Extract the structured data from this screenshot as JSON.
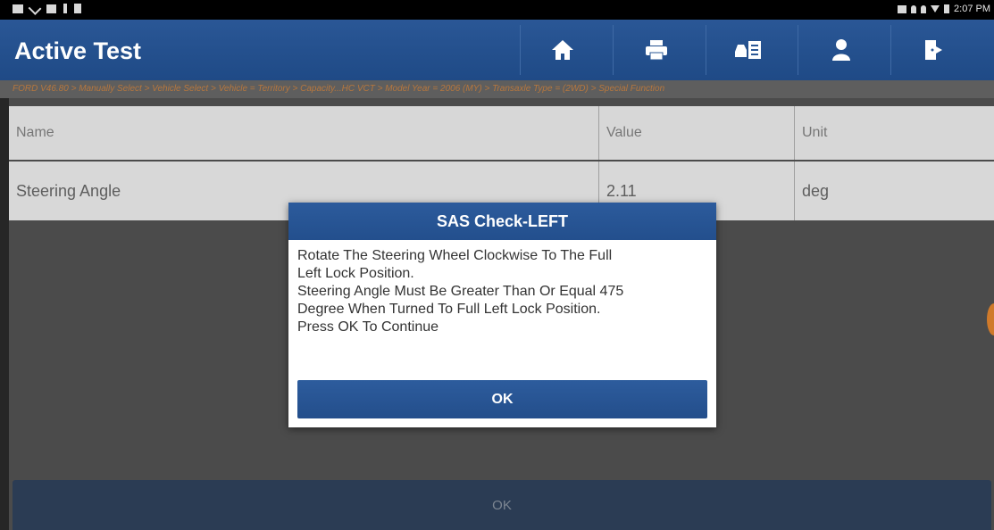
{
  "status_bar": {
    "time": "2:07 PM"
  },
  "header": {
    "title": "Active Test",
    "buttons": [
      {
        "name": "home-icon"
      },
      {
        "name": "print-icon"
      },
      {
        "name": "vehicle-info-icon"
      },
      {
        "name": "user-icon"
      },
      {
        "name": "exit-icon"
      }
    ]
  },
  "breadcrumb": "FORD V46.80 > Manually Select > Vehicle Select > Vehicle = Territory > Capacity...HC VCT > Model Year = 2006 (MY) > Transaxle Type = (2WD) > Special Function",
  "table": {
    "headers": {
      "name": "Name",
      "value": "Value",
      "unit": "Unit"
    },
    "rows": [
      {
        "name": "Steering Angle",
        "value": "2.11",
        "unit": "deg"
      }
    ]
  },
  "bottom_button": "OK",
  "dialog": {
    "title": "SAS Check-LEFT",
    "lines": [
      "Rotate The Steering Wheel Clockwise To The Full",
      "Left Lock Position.",
      "Steering Angle Must Be Greater Than Or Equal 475",
      "Degree When Turned To Full Left Lock Position.",
      "Press OK To Continue"
    ],
    "ok_label": "OK"
  },
  "colors": {
    "header_bg": "#2a5796",
    "breadcrumb_text": "#b7773e",
    "dialog_button": "#2d5c9d"
  }
}
